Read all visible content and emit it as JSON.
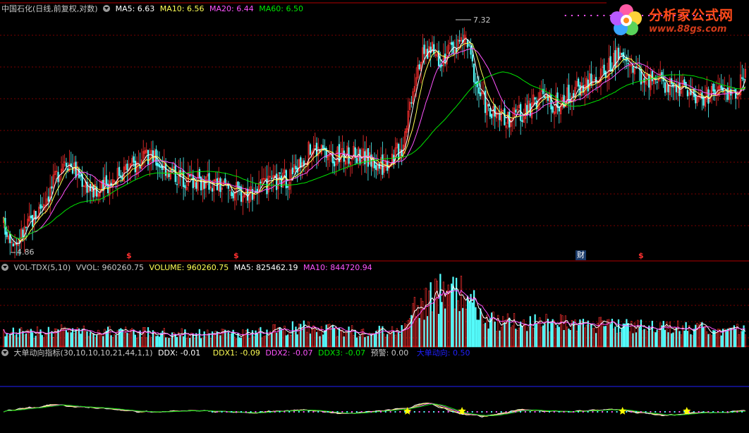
{
  "header": {
    "title": "中国石化(日线,前复权,对数)",
    "ma5": "MA5: 6.63",
    "ma10": "MA10: 6.56",
    "ma20": "MA20: 6.44",
    "ma60": "MA60: 6.50",
    "high_label": "7.32",
    "low_label": "4.86",
    "markers": [
      {
        "text": "$",
        "color": "#ff3030"
      },
      {
        "text": "$",
        "color": "#ff3030"
      },
      {
        "text": "财",
        "color": "#ffffff"
      },
      {
        "text": "$",
        "color": "#ff3030"
      }
    ]
  },
  "logo": {
    "title": "分析家公式网",
    "url": "www.88gs.com",
    "icon": "flower-icon"
  },
  "volume_panel": {
    "title": "VOL-TDX(5,10)",
    "vvol": "VVOL: 960260.75",
    "volume": "VOLUME: 960260.75",
    "ma5": "MA5: 825462.19",
    "ma10": "MA10: 844720.94"
  },
  "ddx_panel": {
    "title": "大单动向指标(30,10,10,10,21,44,1,1)",
    "ddx": "DDX: -0.01",
    "ddx1": "DDX1: -0.09",
    "ddx2": "DDX2: -0.07",
    "ddx3": "DDX3: -0.07",
    "warn": "预警: 0.00",
    "dir": "大单动向: 0.50"
  },
  "colors": {
    "up": "#ff3030",
    "down": "#54fcfc",
    "ma5": "#ffffff",
    "ma10": "#ffff54",
    "ma20": "#ff54ff",
    "ma60": "#00e600",
    "grid": "#7a0000",
    "divider": "#b00000",
    "star": "#ffff00",
    "ddx_dir": "#2020ff"
  },
  "chart_data": {
    "type": "candlestick",
    "price_high": 7.32,
    "price_low": 4.86,
    "price_anchors": [
      [
        0,
        5.1
      ],
      [
        8,
        4.95
      ],
      [
        20,
        5.2
      ],
      [
        30,
        5.45
      ],
      [
        38,
        5.75
      ],
      [
        48,
        5.55
      ],
      [
        58,
        5.38
      ],
      [
        72,
        5.6
      ],
      [
        92,
        5.75
      ],
      [
        110,
        5.55
      ],
      [
        128,
        5.5
      ],
      [
        148,
        5.4
      ],
      [
        162,
        5.45
      ],
      [
        178,
        5.55
      ],
      [
        192,
        5.85
      ],
      [
        205,
        5.75
      ],
      [
        222,
        5.78
      ],
      [
        235,
        5.65
      ],
      [
        248,
        5.85
      ],
      [
        258,
        6.8
      ],
      [
        265,
        6.95
      ],
      [
        272,
        6.85
      ],
      [
        282,
        7.0
      ],
      [
        288,
        7.08
      ],
      [
        295,
        6.5
      ],
      [
        303,
        6.2
      ],
      [
        312,
        6.15
      ],
      [
        325,
        6.22
      ],
      [
        335,
        6.4
      ],
      [
        345,
        6.3
      ],
      [
        358,
        6.5
      ],
      [
        372,
        6.62
      ],
      [
        382,
        6.85
      ],
      [
        392,
        6.75
      ],
      [
        402,
        6.55
      ],
      [
        412,
        6.55
      ],
      [
        425,
        6.48
      ],
      [
        435,
        6.38
      ],
      [
        445,
        6.45
      ],
      [
        455,
        6.42
      ],
      [
        462,
        6.68
      ]
    ],
    "volume_anchors": [
      [
        0,
        210000
      ],
      [
        40,
        260000
      ],
      [
        80,
        230000
      ],
      [
        120,
        210000
      ],
      [
        150,
        200000
      ],
      [
        185,
        310000
      ],
      [
        205,
        260000
      ],
      [
        230,
        230000
      ],
      [
        248,
        290000
      ],
      [
        258,
        660000
      ],
      [
        272,
        830000
      ],
      [
        282,
        900000
      ],
      [
        290,
        750000
      ],
      [
        300,
        420000
      ],
      [
        340,
        380000
      ],
      [
        380,
        330000
      ],
      [
        420,
        300000
      ],
      [
        462,
        280000
      ]
    ],
    "volume_max": 1200000,
    "ddx_anchors": [
      [
        0,
        0.0
      ],
      [
        30,
        0.12
      ],
      [
        60,
        0.05
      ],
      [
        90,
        -0.03
      ],
      [
        120,
        0.0
      ],
      [
        150,
        -0.04
      ],
      [
        185,
        0.02
      ],
      [
        210,
        -0.06
      ],
      [
        235,
        0.0
      ],
      [
        252,
        0.06
      ],
      [
        262,
        0.18
      ],
      [
        275,
        0.02
      ],
      [
        285,
        -0.08
      ],
      [
        300,
        -0.12
      ],
      [
        320,
        0.02
      ],
      [
        350,
        -0.02
      ],
      [
        380,
        0.03
      ],
      [
        410,
        -0.1
      ],
      [
        430,
        -0.04
      ],
      [
        462,
        -0.01
      ]
    ],
    "ddx_levels": {
      "max": 0.5,
      "min": -0.3
    },
    "star_bars": [
      252,
      286,
      386,
      426
    ],
    "bars": 463
  }
}
